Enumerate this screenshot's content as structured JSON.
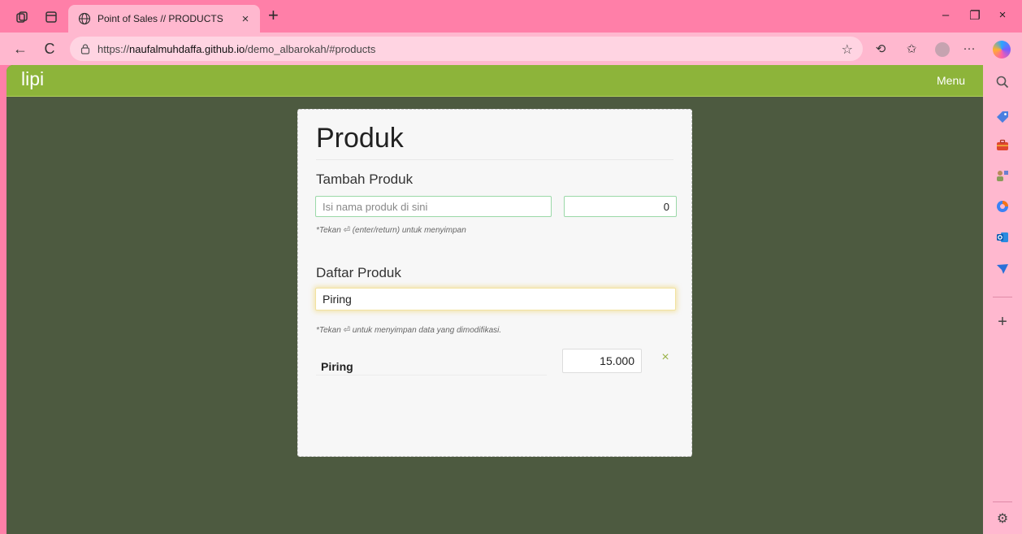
{
  "browser": {
    "tab_title": "Point of Sales // PRODUCTS",
    "tab_close": "×",
    "new_tab": "+",
    "url_prefix": "https://",
    "url_host": "naufalmuhdaffa.github.io",
    "url_path": "/demo_albarokah/#products",
    "window_controls": {
      "minimize": "–",
      "restore": "❐",
      "close": "×"
    },
    "nav": {
      "back": "←",
      "reload": "C"
    },
    "more": "···"
  },
  "app": {
    "brand": "lipi",
    "menu_label": "Menu",
    "accent_color": "#8db43a",
    "background_color": "#4d5a40"
  },
  "card": {
    "title": "Produk",
    "add_section": {
      "heading": "Tambah Produk",
      "name_placeholder": "Isi nama produk di sini",
      "name_value": "",
      "price_value": "0",
      "hint": "*Tekan ⏎ (enter/return) untuk menyimpan"
    },
    "list_section": {
      "heading": "Daftar Produk",
      "edit_value": "Piring",
      "hint": "*Tekan ⏎ untuk menyimpan data yang dimodifikasi.",
      "items": [
        {
          "name": "Piring",
          "price": "15.000",
          "delete_glyph": "×"
        }
      ]
    }
  },
  "sidebar": {
    "icons": [
      "search-icon",
      "tag-icon",
      "briefcase-icon",
      "games-icon",
      "copilot-icon",
      "outlook-icon",
      "send-icon"
    ],
    "add_glyph": "+",
    "settings_glyph": "⚙"
  }
}
